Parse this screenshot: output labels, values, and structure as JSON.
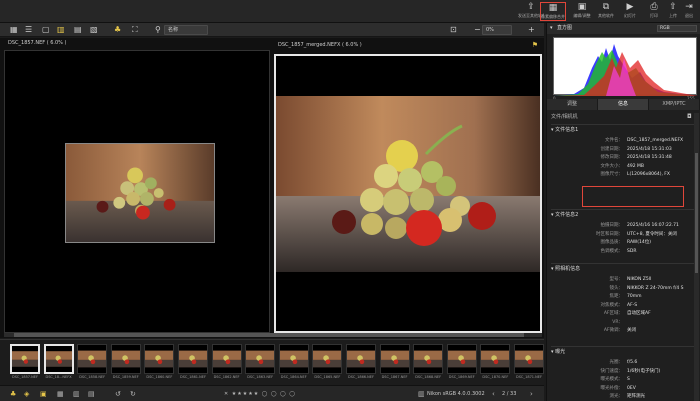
{
  "topbar": {
    "buttons": [
      {
        "label": "发送至其他软件",
        "icon": "export-icon"
      },
      {
        "label": "像素偏移合并",
        "icon": "pixel-shift-merge-icon"
      },
      {
        "label": "编辑/调整",
        "icon": "edit-icon"
      },
      {
        "label": "其他软件",
        "icon": "open-with-icon"
      },
      {
        "label": "幻灯片",
        "icon": "slideshow-icon"
      },
      {
        "label": "打印",
        "icon": "print-icon"
      },
      {
        "label": "上传",
        "icon": "upload-icon"
      },
      {
        "label": "退出",
        "icon": "exit-icon"
      }
    ]
  },
  "toolbar": {
    "sort_label": "名称",
    "zoom_value": "0%"
  },
  "viewer": {
    "left_title": "DSC_1857.NEF ( 6.0% )",
    "right_title": "DSC_1857_merged.NEFX ( 6.0% )"
  },
  "filmstrip": {
    "items": [
      {
        "label": "DSC_1857.NEF",
        "selected": true
      },
      {
        "label": "DSC_18...NEFX",
        "selected": true
      },
      {
        "label": "DSC_1858.NEF",
        "selected": false
      },
      {
        "label": "DSC_1859.NEF",
        "selected": false
      },
      {
        "label": "DSC_1860.NEF",
        "selected": false
      },
      {
        "label": "DSC_1861.NEF",
        "selected": false
      },
      {
        "label": "DSC_1862.NEF",
        "selected": false
      },
      {
        "label": "DSC_1863.NEF",
        "selected": false
      },
      {
        "label": "DSC_1864.NEF",
        "selected": false
      },
      {
        "label": "DSC_1865.NEF",
        "selected": false
      },
      {
        "label": "DSC_1866.NEF",
        "selected": false
      },
      {
        "label": "DSC_1867.NEF",
        "selected": false
      },
      {
        "label": "DSC_1868.NEF",
        "selected": false
      },
      {
        "label": "DSC_1869.NEF",
        "selected": false
      },
      {
        "label": "DSC_1870.NEF",
        "selected": false
      },
      {
        "label": "DSC_1871.NEF",
        "selected": false
      }
    ]
  },
  "statusbar": {
    "color_profile": "Nikon sRGB 4.0.0.3002",
    "page": "2 / 33"
  },
  "side": {
    "histogram_title": "直方图",
    "histogram_channel": "RGB",
    "histogram_min": "0",
    "histogram_max": "255",
    "tabs": [
      "调整",
      "信息",
      "XMP/IPTC"
    ],
    "active_tab": 1,
    "camera_section": "文件/相机机",
    "file_info_title": "文件信息1",
    "file_info": [
      {
        "k": "文件名：",
        "v": "DSC_1857_merged.NEFX"
      },
      {
        "k": "创建日期：",
        "v": "2025/4/18 15:31:03"
      },
      {
        "k": "修改日期：",
        "v": "2025/4/18 15:31:48"
      },
      {
        "k": "文件大小：",
        "v": "492 MB"
      },
      {
        "k": "图像尺寸：",
        "v": "L(12096x8064), FX"
      }
    ],
    "file_info2_title": "文件信息2",
    "file_info2": [
      {
        "k": "拍摄日期：",
        "v": "2025/4/16 16:07:22.71"
      },
      {
        "k": "时区和日期：",
        "v": "UTC+8, 夏令时间：关闭"
      },
      {
        "k": "图像品质：",
        "v": "RAW(14位)"
      },
      {
        "k": "色调模式：",
        "v": "SDR"
      }
    ],
    "camera_title": "照相机信息",
    "camera": [
      {
        "k": "型号：",
        "v": "NIKON Z5II"
      },
      {
        "k": "镜头：",
        "v": "NIKKOR Z 24-70mm f/4 S"
      },
      {
        "k": "焦距：",
        "v": "70mm"
      },
      {
        "k": "对焦模式：",
        "v": "AF-S"
      },
      {
        "k": "AF区域：",
        "v": "自动区域AF"
      },
      {
        "k": "VR：",
        "v": ""
      },
      {
        "k": "AF微调：",
        "v": "关闭"
      }
    ],
    "exposure_title": "曝光",
    "exposure": [
      {
        "k": "光圈：",
        "v": "f/5.6"
      },
      {
        "k": "快门速度：",
        "v": "1/6秒(电子快门)"
      },
      {
        "k": "曝光模式：",
        "v": "S"
      },
      {
        "k": "曝光补偿：",
        "v": "0EV"
      },
      {
        "k": "测光：",
        "v": "矩阵测光"
      },
      {
        "k": "ISO感光度：",
        "v": "ISO 3200"
      }
    ]
  }
}
